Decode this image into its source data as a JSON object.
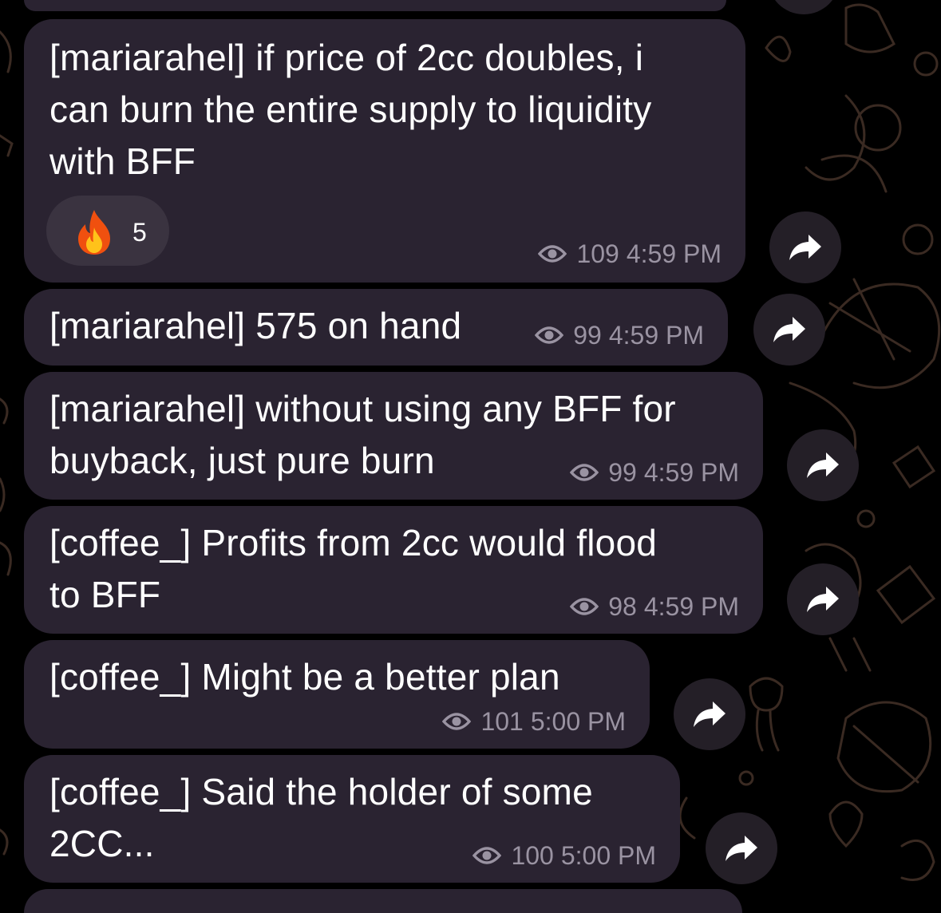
{
  "messages": [
    {
      "author": "mariarahel",
      "text": "[mariarahel] if price of 2cc doubles, i\ncan burn the entire supply to liquidity\nwith BFF",
      "reaction": {
        "emoji": "fire-emoji",
        "count": "5"
      },
      "views": "109",
      "time": "4:59 PM"
    },
    {
      "author": "mariarahel",
      "text": "[mariarahel] 575 on hand",
      "views": "99",
      "time": "4:59 PM"
    },
    {
      "author": "mariarahel",
      "text": "[mariarahel] without using any BFF for\nbuyback, just pure burn",
      "views": "99",
      "time": "4:59 PM"
    },
    {
      "author": "coffee_",
      "text": "[coffee_] Profits from 2cc would flood\nto BFF",
      "views": "98",
      "time": "4:59 PM"
    },
    {
      "author": "coffee_",
      "text": "[coffee_] Might be a better plan",
      "views": "101",
      "time": "5:00 PM"
    },
    {
      "author": "coffee_",
      "text": "[coffee_] Said the holder of some\n2CC...",
      "views": "100",
      "time": "5:00 PM"
    }
  ],
  "icons": {
    "views": "eye-icon",
    "forward": "share-arrow-icon"
  },
  "colors": {
    "background": "#000000",
    "bubble": "#2a2331",
    "meta_text": "#9a93a2",
    "forward_button": "#241f27",
    "doodle": "#3a2a22"
  }
}
